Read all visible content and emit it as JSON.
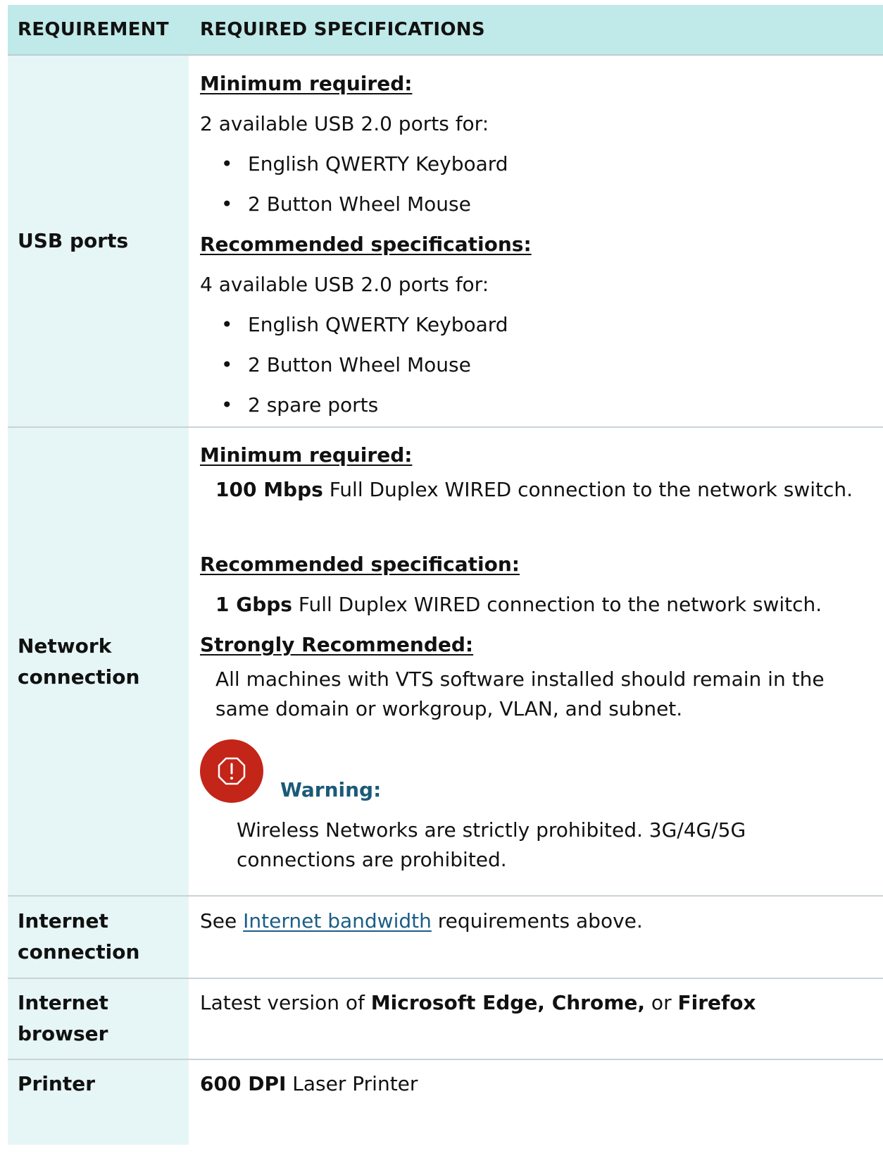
{
  "header": {
    "col1": "REQUIREMENT",
    "col2": "REQUIRED SPECIFICATIONS"
  },
  "usb": {
    "label": "USB ports",
    "min_heading": "Minimum required:",
    "min_text": "2 available USB 2.0 ports for:",
    "min_items": [
      "English QWERTY Keyboard",
      "2 Button Wheel Mouse"
    ],
    "rec_heading": "Recommended specifications:",
    "rec_text": "4 available USB 2.0 ports for:",
    "rec_items": [
      "English QWERTY Keyboard",
      "2 Button Wheel Mouse",
      "2 spare ports"
    ]
  },
  "network": {
    "label_line1": "Network",
    "label_line2": "connection",
    "min_heading": "Minimum required:",
    "min_bold": "100 Mbps",
    "min_rest": " Full Duplex WIRED connection to the network switch.",
    "rec_heading": "Recommended specification:",
    "rec_bold": "1 Gbps",
    "rec_rest": " Full Duplex WIRED connection to the network switch.",
    "strong_heading": "Strongly Recommended:",
    "strong_text": "All machines with VTS software installed should remain in the same domain or workgroup, VLAN, and subnet.",
    "warning_title": "Warning:",
    "warning_text": "Wireless Networks are strictly prohibited. 3G/4G/5G connections are prohibited."
  },
  "internet": {
    "label_line1": "Internet",
    "label_line2": "connection",
    "pre": "See ",
    "link": "Internet bandwidth",
    "post": " requirements above."
  },
  "browser": {
    "label_line1": "Internet",
    "label_line2": "browser",
    "pre": "Latest version of ",
    "b1": "Microsoft Edge, Chrome,",
    "mid": " or ",
    "b2": "Firefox"
  },
  "printer": {
    "label": "Printer",
    "bold": "600 DPI",
    "rest": " Laser Printer"
  },
  "icons": {
    "warning": "warning-octagon-icon"
  },
  "colors": {
    "header_bg": "#c0e9e9",
    "label_bg": "#e6f5f5",
    "warning_red": "#c32519",
    "warning_title": "#1b5a78",
    "link": "#1b5e86"
  }
}
